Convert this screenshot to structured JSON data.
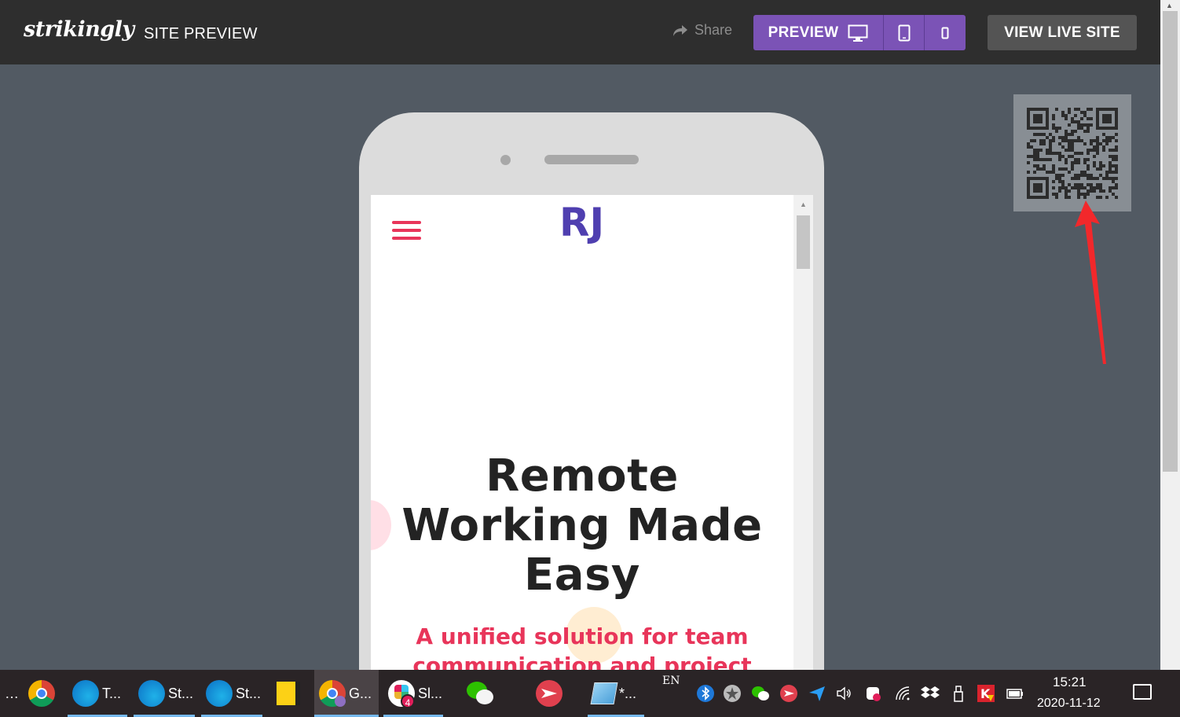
{
  "header": {
    "logo_text": "strikingly",
    "title": "SITE PREVIEW",
    "share_label": "Share",
    "preview_label": "PREVIEW",
    "view_live_label": "VIEW LIVE SITE",
    "icons": [
      "share-icon",
      "desktop-icon",
      "tablet-icon",
      "mobile-icon"
    ],
    "accent_color": "#7b53b6"
  },
  "phone_site": {
    "logo_text": "RJ",
    "logo_color": "#4f3fb0",
    "hero_title_line1": "Remote",
    "hero_title_line2": "Working Made",
    "hero_title_line3": "Easy",
    "hero_subtitle_line1": "A unified solution for team",
    "hero_subtitle_line2": "communication and project",
    "accent_color": "#e8355a"
  },
  "qr_panel": {
    "icon": "qr-code-icon"
  },
  "taskbar": {
    "apps": [
      {
        "label": "…"
      },
      {
        "label": ""
      },
      {
        "label": "T..."
      },
      {
        "label": "St..."
      },
      {
        "label": "St..."
      },
      {
        "label": ""
      },
      {
        "label": "G..."
      },
      {
        "label": "Sl..."
      },
      {
        "label": ""
      },
      {
        "label": ""
      },
      {
        "label": "*..."
      }
    ],
    "slack_badge": "4",
    "language": "EN",
    "time": "15:21",
    "date": "2020-11-12"
  }
}
